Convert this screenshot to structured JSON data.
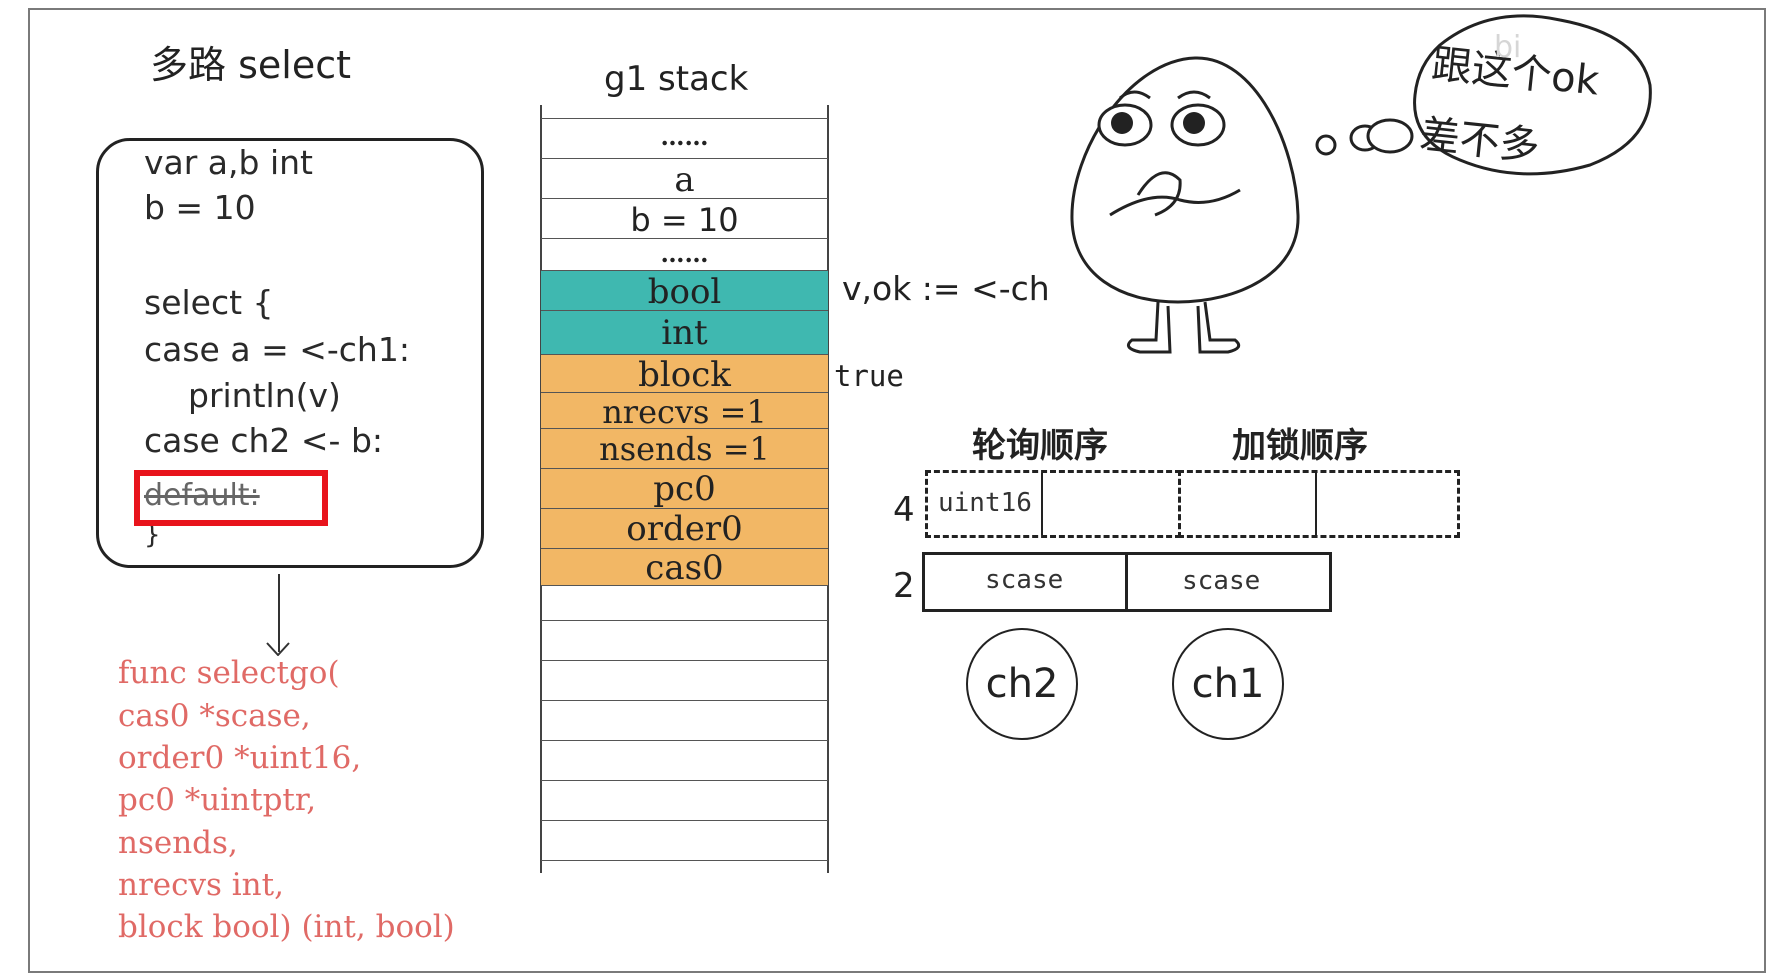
{
  "title": "多路 select",
  "code_lines": [
    "var a,b int",
    "b = 10",
    "select {",
    "case a = <-ch1:",
    "println(v)",
    "case ch2 <- b:",
    "default:",
    "}"
  ],
  "func_lines": [
    "func selectgo(",
    "cas0 *scase,",
    "order0 *uint16,",
    "pc0 *uintptr,",
    "nsends,",
    "nrecvs int,",
    "block bool) (int, bool)"
  ],
  "stack": {
    "title": "g1 stack",
    "rows": [
      "……",
      "a",
      "b = 10",
      "……",
      "bool",
      "int",
      "block",
      "nrecvs =1",
      "nsends =1",
      "pc0",
      "order0",
      "cas0"
    ]
  },
  "annotations": {
    "recv": "v,ok := <-ch",
    "block_value": "true"
  },
  "headers": {
    "poll": "轮询顺序",
    "lock": "加锁顺序"
  },
  "arrays": {
    "order_size": "4",
    "order_cell": "uint16",
    "scase_size": "2",
    "scase_cells": [
      "scase",
      "scase"
    ]
  },
  "channels": [
    "ch2",
    "ch1"
  ],
  "thought_bubble": [
    "跟这个ok",
    "差不多"
  ],
  "watermark": "bi",
  "colors": {
    "teal": "#3fb8b0",
    "orange": "#f2b765",
    "highlight": "#e8141c",
    "func_text": "#e06a66"
  }
}
